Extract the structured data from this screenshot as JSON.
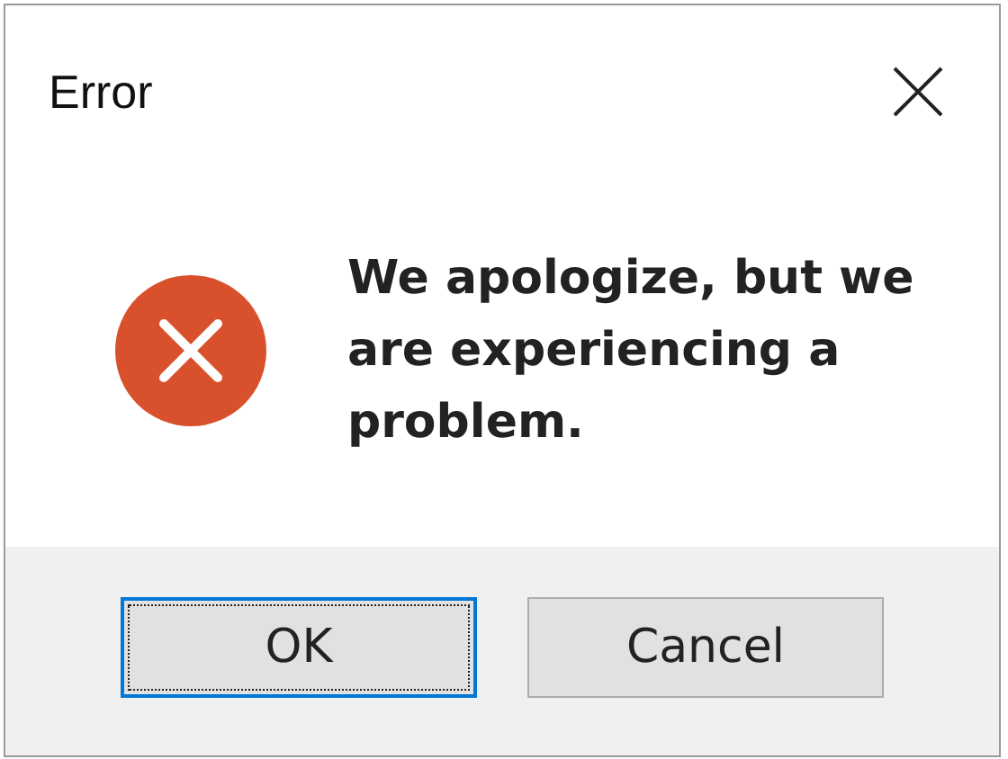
{
  "window": {
    "title": "Error"
  },
  "message": {
    "kind": "error",
    "text": "We apologize, but we are experiencing a problem."
  },
  "buttons": [
    {
      "label": "OK",
      "selected": true
    },
    {
      "label": "Cancel",
      "selected": false
    }
  ]
}
